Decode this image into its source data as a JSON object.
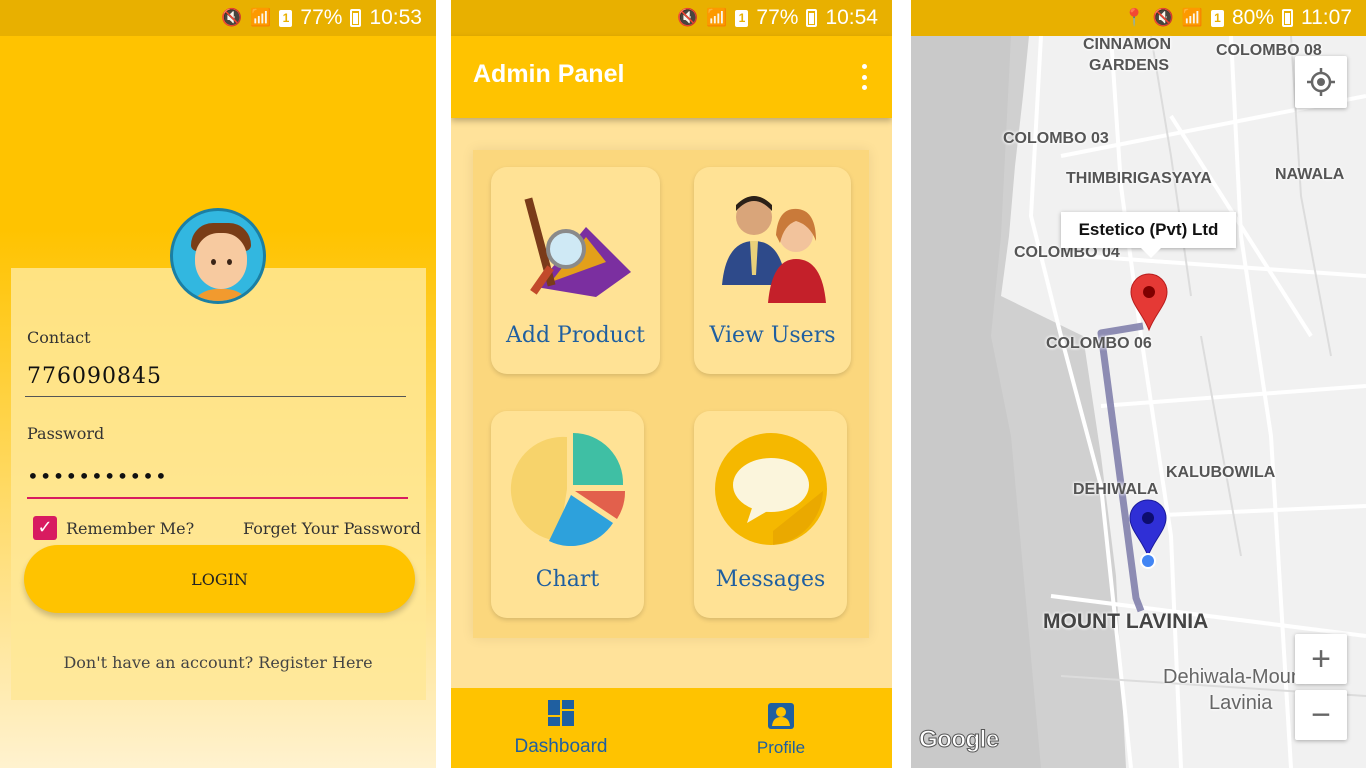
{
  "login_screen": {
    "status": {
      "battery": "77%",
      "time": "10:53"
    },
    "contact_label": "Contact",
    "contact_value": "776090845",
    "password_label": "Password",
    "password_value": "•••••••••••",
    "remember_label": "Remember Me?",
    "forgot_label": "Forget Your Password",
    "login_label": "LOGIN",
    "register_text": "Don't have an account? Register Here",
    "accent_color": "#ffc300"
  },
  "admin_screen": {
    "status": {
      "battery": "77%",
      "time": "10:54"
    },
    "title": "Admin Panel",
    "tiles": [
      {
        "label": "Add Product",
        "icon": "product-icon"
      },
      {
        "label": "View Users",
        "icon": "users-icon"
      },
      {
        "label": "Chart",
        "icon": "pie-chart-icon"
      },
      {
        "label": "Messages",
        "icon": "message-icon"
      }
    ],
    "nav": [
      {
        "label": "Dashboard",
        "icon": "dashboard-icon"
      },
      {
        "label": "Profile",
        "icon": "profile-icon"
      }
    ]
  },
  "map_screen": {
    "status": {
      "battery": "80%",
      "time": "11:07"
    },
    "places": {
      "cinnamon": "CINNAMON",
      "gardens": "GARDENS",
      "colombo08": "COLOMBO 08",
      "colombo03": "COLOMBO 03",
      "thimbirigasyaya": "THIMBIRIGASYAYA",
      "nawala": "NAWALA",
      "colombo04": "COLOMBO 04",
      "colombo06": "COLOMBO 06",
      "kalubowila": "KALUBOWILA",
      "dehiwala": "DEHIWALA",
      "mount_lavinia": "MOUNT LAVINIA",
      "dehiwala_mount1": "Dehiwala-Mount",
      "dehiwala_mount2": "Lavinia"
    },
    "info_window": "Estetico (Pvt) Ltd",
    "zoom_in": "+",
    "zoom_out": "−",
    "logo": "Google",
    "route_color": "#7b7aa8"
  }
}
